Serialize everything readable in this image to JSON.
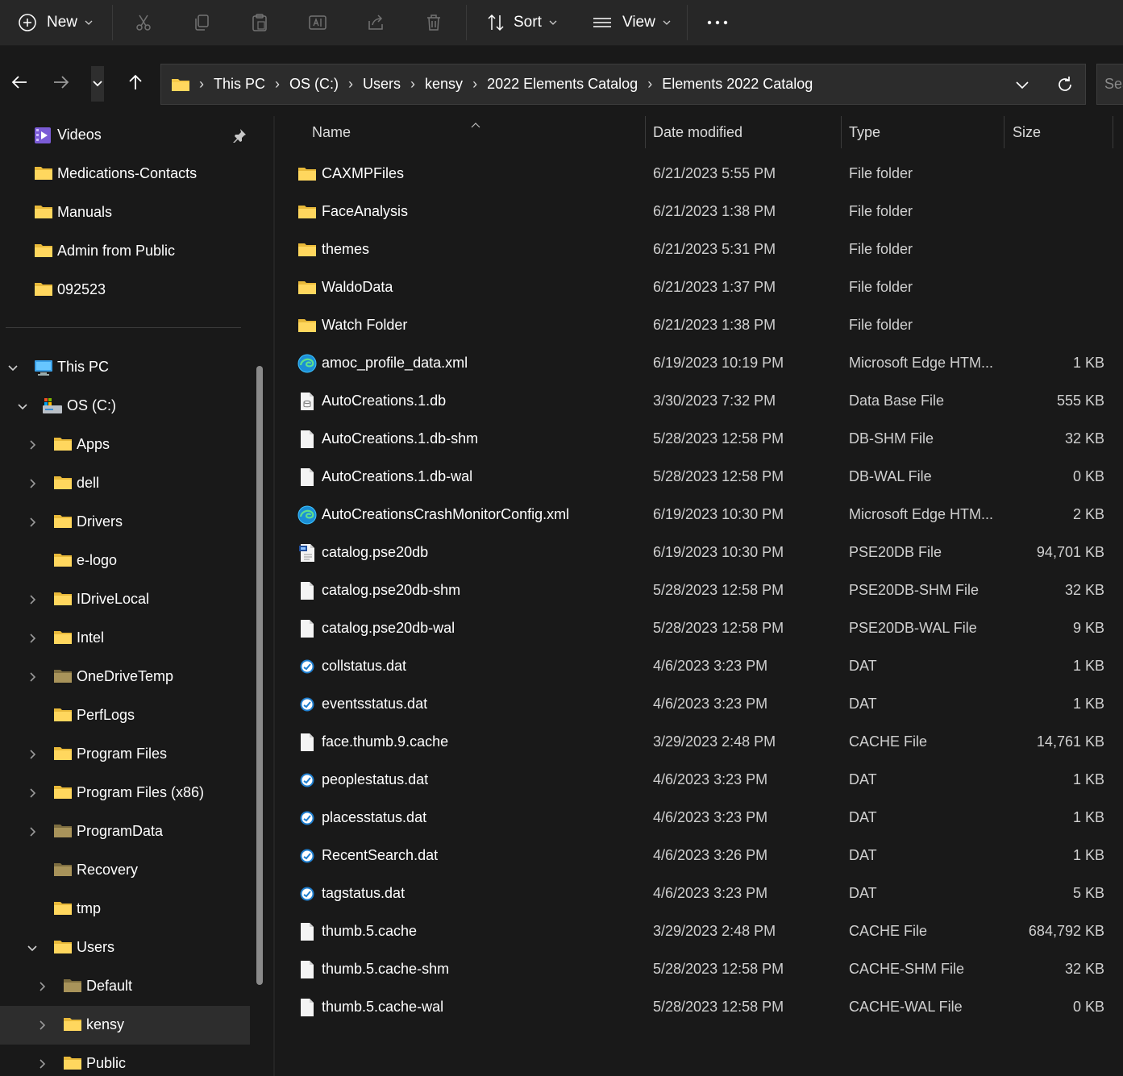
{
  "toolbar": {
    "new_label": "New",
    "sort_label": "Sort",
    "view_label": "View"
  },
  "address": {
    "crumbs": [
      "This PC",
      "OS (C:)",
      "Users",
      "kensy",
      "2022 Elements Catalog",
      "Elements 2022 Catalog"
    ],
    "search_placeholder": "Sea"
  },
  "sidebar": {
    "items": [
      {
        "label": "Videos",
        "icon": "videos-icon",
        "pinned": true
      },
      {
        "label": "Medications-Contacts",
        "icon": "folder-icon"
      },
      {
        "label": "Manuals",
        "icon": "folder-icon"
      },
      {
        "label": "Admin from Public",
        "icon": "folder-icon"
      },
      {
        "label": "092523",
        "icon": "folder-icon"
      },
      {
        "label": "This PC",
        "icon": "pc-icon",
        "expanded": true
      },
      {
        "label": "OS (C:)",
        "icon": "drive-icon",
        "expanded": true
      },
      {
        "label": "Apps",
        "icon": "folder-icon",
        "expandable": true
      },
      {
        "label": "dell",
        "icon": "folder-icon",
        "expandable": true
      },
      {
        "label": "Drivers",
        "icon": "folder-icon",
        "expandable": true
      },
      {
        "label": "e-logo",
        "icon": "folder-icon"
      },
      {
        "label": "IDriveLocal",
        "icon": "folder-icon",
        "expandable": true
      },
      {
        "label": "Intel",
        "icon": "folder-icon",
        "expandable": true
      },
      {
        "label": "OneDriveTemp",
        "icon": "folder-dim-icon",
        "expandable": true
      },
      {
        "label": "PerfLogs",
        "icon": "folder-icon"
      },
      {
        "label": "Program Files",
        "icon": "folder-icon",
        "expandable": true
      },
      {
        "label": "Program Files (x86)",
        "icon": "folder-icon",
        "expandable": true
      },
      {
        "label": "ProgramData",
        "icon": "folder-dim-icon",
        "expandable": true
      },
      {
        "label": "Recovery",
        "icon": "folder-dim-icon"
      },
      {
        "label": "tmp",
        "icon": "folder-icon"
      },
      {
        "label": "Users",
        "icon": "folder-icon",
        "expanded": true
      },
      {
        "label": "Default",
        "icon": "folder-dim-icon",
        "expandable": true
      },
      {
        "label": "kensy",
        "icon": "folder-icon",
        "expandable": true,
        "selected": true
      },
      {
        "label": "Public",
        "icon": "folder-icon",
        "expandable": true
      }
    ]
  },
  "columns": {
    "name": "Name",
    "date": "Date modified",
    "type": "Type",
    "size": "Size"
  },
  "files": [
    {
      "name": "CAXMPFiles",
      "date": "6/21/2023 5:55 PM",
      "type": "File folder",
      "size": "",
      "icon": "folder-icon"
    },
    {
      "name": "FaceAnalysis",
      "date": "6/21/2023 1:38 PM",
      "type": "File folder",
      "size": "",
      "icon": "folder-icon"
    },
    {
      "name": "themes",
      "date": "6/21/2023 5:31 PM",
      "type": "File folder",
      "size": "",
      "icon": "folder-icon"
    },
    {
      "name": "WaldoData",
      "date": "6/21/2023 1:37 PM",
      "type": "File folder",
      "size": "",
      "icon": "folder-icon"
    },
    {
      "name": "Watch Folder",
      "date": "6/21/2023 1:38 PM",
      "type": "File folder",
      "size": "",
      "icon": "folder-icon"
    },
    {
      "name": "amoc_profile_data.xml",
      "date": "6/19/2023 10:19 PM",
      "type": "Microsoft Edge HTM...",
      "size": "1 KB",
      "icon": "edge-icon"
    },
    {
      "name": "AutoCreations.1.db",
      "date": "3/30/2023 7:32 PM",
      "type": "Data Base File",
      "size": "555 KB",
      "icon": "db-file-icon"
    },
    {
      "name": "AutoCreations.1.db-shm",
      "date": "5/28/2023 12:58 PM",
      "type": "DB-SHM File",
      "size": "32 KB",
      "icon": "file-icon"
    },
    {
      "name": "AutoCreations.1.db-wal",
      "date": "5/28/2023 12:58 PM",
      "type": "DB-WAL File",
      "size": "0 KB",
      "icon": "file-icon"
    },
    {
      "name": "AutoCreationsCrashMonitorConfig.xml",
      "date": "6/19/2023 10:30 PM",
      "type": "Microsoft Edge HTM...",
      "size": "2 KB",
      "icon": "edge-icon"
    },
    {
      "name": "catalog.pse20db",
      "date": "6/19/2023 10:30 PM",
      "type": "PSE20DB File",
      "size": "94,701 KB",
      "icon": "pse-file-icon"
    },
    {
      "name": "catalog.pse20db-shm",
      "date": "5/28/2023 12:58 PM",
      "type": "PSE20DB-SHM File",
      "size": "32 KB",
      "icon": "file-icon"
    },
    {
      "name": "catalog.pse20db-wal",
      "date": "5/28/2023 12:58 PM",
      "type": "PSE20DB-WAL File",
      "size": "9 KB",
      "icon": "file-icon"
    },
    {
      "name": "collstatus.dat",
      "date": "4/6/2023 3:23 PM",
      "type": "DAT",
      "size": "1 KB",
      "icon": "dat-icon"
    },
    {
      "name": "eventsstatus.dat",
      "date": "4/6/2023 3:23 PM",
      "type": "DAT",
      "size": "1 KB",
      "icon": "dat-icon"
    },
    {
      "name": "face.thumb.9.cache",
      "date": "3/29/2023 2:48 PM",
      "type": "CACHE File",
      "size": "14,761 KB",
      "icon": "file-icon"
    },
    {
      "name": "peoplestatus.dat",
      "date": "4/6/2023 3:23 PM",
      "type": "DAT",
      "size": "1 KB",
      "icon": "dat-icon"
    },
    {
      "name": "placesstatus.dat",
      "date": "4/6/2023 3:23 PM",
      "type": "DAT",
      "size": "1 KB",
      "icon": "dat-icon"
    },
    {
      "name": "RecentSearch.dat",
      "date": "4/6/2023 3:26 PM",
      "type": "DAT",
      "size": "1 KB",
      "icon": "dat-icon"
    },
    {
      "name": "tagstatus.dat",
      "date": "4/6/2023 3:23 PM",
      "type": "DAT",
      "size": "5 KB",
      "icon": "dat-icon"
    },
    {
      "name": "thumb.5.cache",
      "date": "3/29/2023 2:48 PM",
      "type": "CACHE File",
      "size": "684,792 KB",
      "icon": "file-icon"
    },
    {
      "name": "thumb.5.cache-shm",
      "date": "5/28/2023 12:58 PM",
      "type": "CACHE-SHM File",
      "size": "32 KB",
      "icon": "file-icon"
    },
    {
      "name": "thumb.5.cache-wal",
      "date": "5/28/2023 12:58 PM",
      "type": "CACHE-WAL File",
      "size": "0 KB",
      "icon": "file-icon"
    }
  ],
  "colors": {
    "background": "#191919",
    "toolbar": "#272727",
    "folder": "#f7c948",
    "folder_dim": "#9c8a55",
    "accent": "#4cc2ff"
  }
}
